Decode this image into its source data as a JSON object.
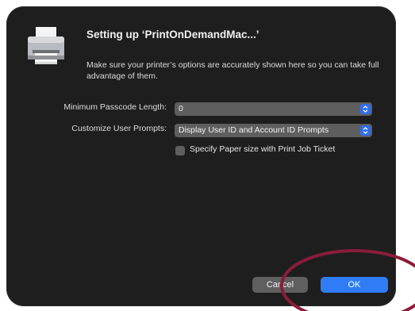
{
  "dialog": {
    "title": "Setting up ‘PrintOnDemandMac...’",
    "message": "Make sure your printer’s options are accurately shown here so you can take full advantage of them.",
    "icon": "printer-icon"
  },
  "options": {
    "passcode_label": "Minimum Passcode Length:",
    "passcode_value": "0",
    "prompts_label": "Customize User Prompts:",
    "prompts_value": "Display User ID and Account ID Prompts",
    "paper_size_label": "Specify Paper size with Print Job Ticket",
    "paper_size_checked": false
  },
  "buttons": {
    "cancel": "Cancel",
    "ok": "OK"
  },
  "colors": {
    "dialog_bg": "#1e1e1e",
    "accent": "#2f7cf6",
    "popup_bg": "#5e5e5e",
    "annotation": "#8a1c3a"
  }
}
